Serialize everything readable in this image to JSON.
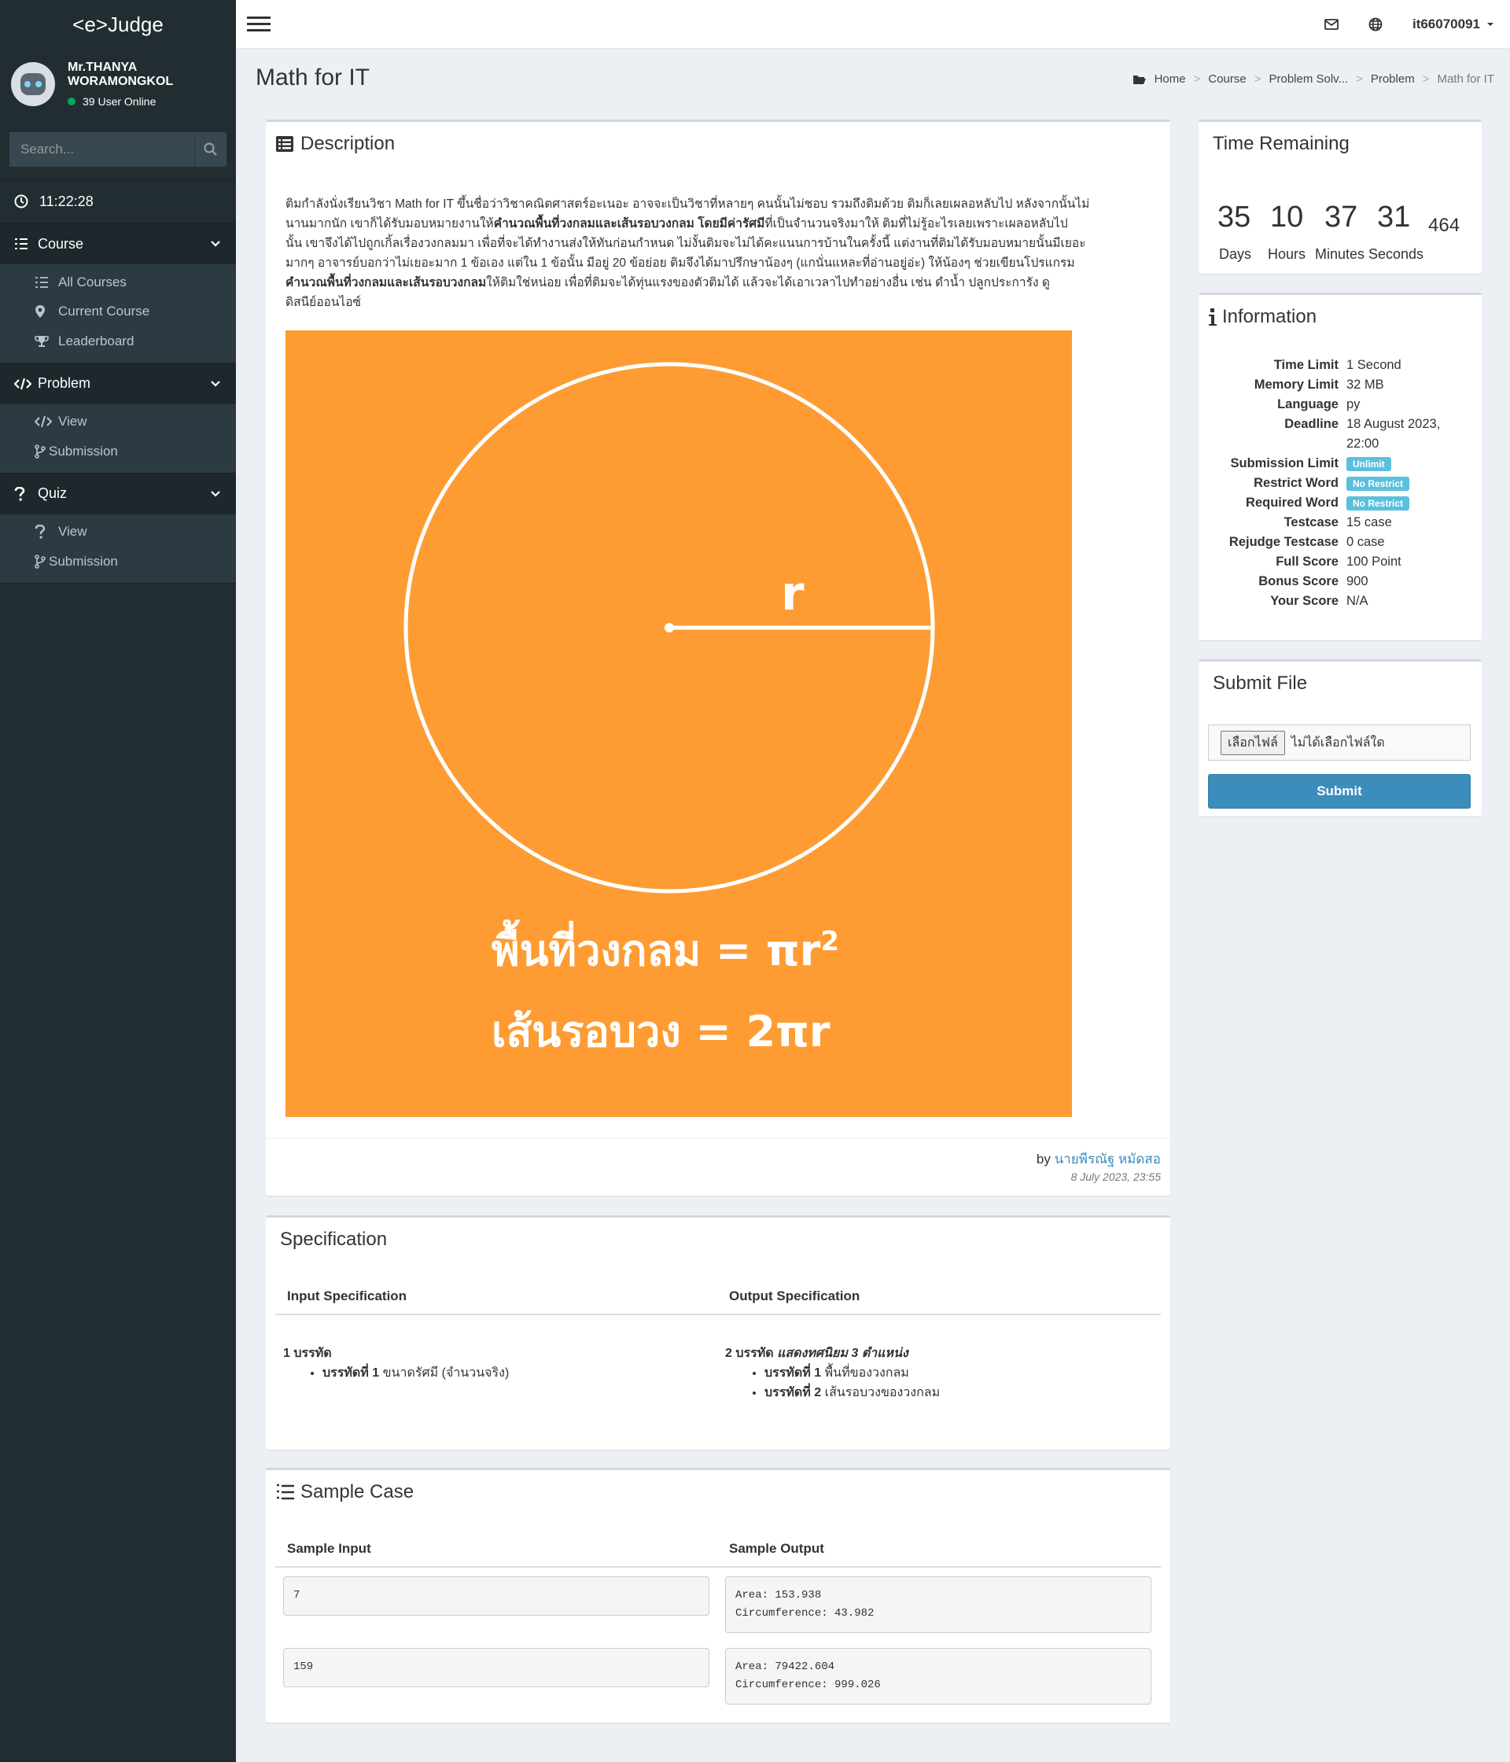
{
  "app": {
    "logo": "<e>Judge"
  },
  "user": {
    "name_line1": "Mr.THANYA",
    "name_line2": "WORAMONGKOL",
    "online": "39 User Online"
  },
  "search": {
    "placeholder": "Search..."
  },
  "clock": {
    "time": "11:22:28"
  },
  "sidebar": {
    "course": {
      "label": "Course",
      "items": [
        "All Courses",
        "Current Course",
        "Leaderboard"
      ]
    },
    "problem": {
      "label": "Problem",
      "items": [
        "View",
        "Submission"
      ]
    },
    "quiz": {
      "label": "Quiz",
      "items": [
        "View",
        "Submission"
      ]
    }
  },
  "topbar": {
    "username": "it66070091"
  },
  "page": {
    "title": "Math for IT"
  },
  "breadcrumb": [
    "Home",
    "Course",
    "Problem Solv...",
    "Problem",
    "Math for IT"
  ],
  "description": {
    "title": "Description",
    "lines": [
      [
        "ติมกำลังนั่งเรียนวิชา Math for IT ขึ้นชื่อว่าวิชาคณิตศาสตร์อะเนอะ อาจจะเป็นวิชาที่หลายๆ คนนั้นไม่ชอบ รวมถึงติมด้วย ติมก็เลยเผลอหลับไป หลังจากนั้นไม่"
      ],
      [
        "นานมากนัก เขาก็ได้รับมอบหมายงานให้",
        "คำนวณพื้นที่วงกลมและเส้นรอบวงกลม โดยมีค่ารัศมี",
        "ที่เป็นจำนวนจริงมาให้ ติมที่ไม่รู้อะไรเลยเพราะเผลอหลับไป"
      ],
      [
        "นั้น เขาจึงได้ไปถูกเกิ้ลเรื่องวงกลมมา เพื่อที่จะได้ทำงานส่งให้ทันก่อนกำหนด ไม่งั้นติมจะไม่ได้คะแนนการบ้านในครั้งนี้ แต่งานที่ติมได้รับมอบหมายนั้นมีเยอะ"
      ],
      [
        "มากๆ อาจารย์บอกว่าไม่เยอะมาก 1 ข้อเอง แต่ใน 1 ข้อนั้น มีอยู่ 20 ข้อย่อย ติมจึงได้มาปรึกษาน้องๆ (แกนั่นแหละที่อ่านอยู่อ่ะ) ให้น้องๆ ช่วยเขียนโปรแกรม"
      ],
      [
        "",
        "คำนวณพื้นที่วงกลมและเส้นรอบวงกลม",
        "ให้ติมใช่หน่อย เพื่อที่ติมจะได้ทุ่นแรงของตัวติมได้ แล้วจะได้เอาเวลาไปทำอย่างอื่น เช่น ดำน้ำ ปลูกประการัง ดู"
      ],
      [
        "ดิสนีย์ออนไอซ์"
      ]
    ],
    "figure": {
      "label_r": "r",
      "area_text": "พื้นที่วงกลม",
      "area_formula": "= πr",
      "area_sup": "2",
      "circ_text": "เส้นรอบวง",
      "circ_formula": "= 2πr"
    },
    "by": "by",
    "author": "นายพีรณัฐ หมัดสอ",
    "date": "8 July 2023, 23:55"
  },
  "specification": {
    "title": "Specification",
    "input_header": "Input Specification",
    "output_header": "Output Specification",
    "input_lead": "1 บรรทัด",
    "input_items": [
      {
        "b": "บรรทัดที่ 1",
        "t": " ขนาดรัศมี (จำนวนจริง)"
      }
    ],
    "output_lead": "2 บรรทัด",
    "output_lead_em": " แสดงทศนิยม 3 ตำแหน่ง",
    "output_items": [
      {
        "b": "บรรทัดที่ 1",
        "t": " พื้นที่ของวงกลม"
      },
      {
        "b": "บรรทัดที่ 2",
        "t": " เส้นรอบวงของวงกลม"
      }
    ]
  },
  "sample": {
    "title": "Sample Case",
    "input_header": "Sample Input",
    "output_header": "Sample Output",
    "cases": [
      {
        "input": "7",
        "output": "Area: 153.938\nCircumference: 43.982"
      },
      {
        "input": "159",
        "output": "Area: 79422.604\nCircumference: 999.026"
      }
    ]
  },
  "timer": {
    "title": "Time Remaining",
    "days": "35",
    "hours": "10",
    "minutes": "37",
    "seconds": "31",
    "ms": "464",
    "days_label": "Days",
    "hours_label": "Hours",
    "minutes_label": "Minutes",
    "seconds_label": "Seconds"
  },
  "info": {
    "title": "Information",
    "rows": [
      {
        "k": "Time Limit",
        "v": "1 Second"
      },
      {
        "k": "Memory Limit",
        "v": "32 MB"
      },
      {
        "k": "Language",
        "v": "py"
      },
      {
        "k": "Deadline",
        "v": "18 August 2023,",
        "v2": "22:00"
      },
      {
        "k": "Submission Limit",
        "badge": "Unlimit"
      },
      {
        "k": "Restrict Word",
        "badge": "No Restrict"
      },
      {
        "k": "Required Word",
        "badge": "No Restrict"
      },
      {
        "k": "Testcase",
        "v": "15 case"
      },
      {
        "k": "Rejudge Testcase",
        "v": "0 case"
      },
      {
        "k": "Full Score",
        "v": "100 Point"
      },
      {
        "k": "Bonus Score",
        "v": "900"
      },
      {
        "k": "Your Score",
        "v": "N/A"
      }
    ]
  },
  "submit": {
    "title": "Submit File",
    "choose": "เลือกไฟล์",
    "no_file": "ไม่ได้เลือกไฟล์ใด",
    "button": "Submit"
  }
}
